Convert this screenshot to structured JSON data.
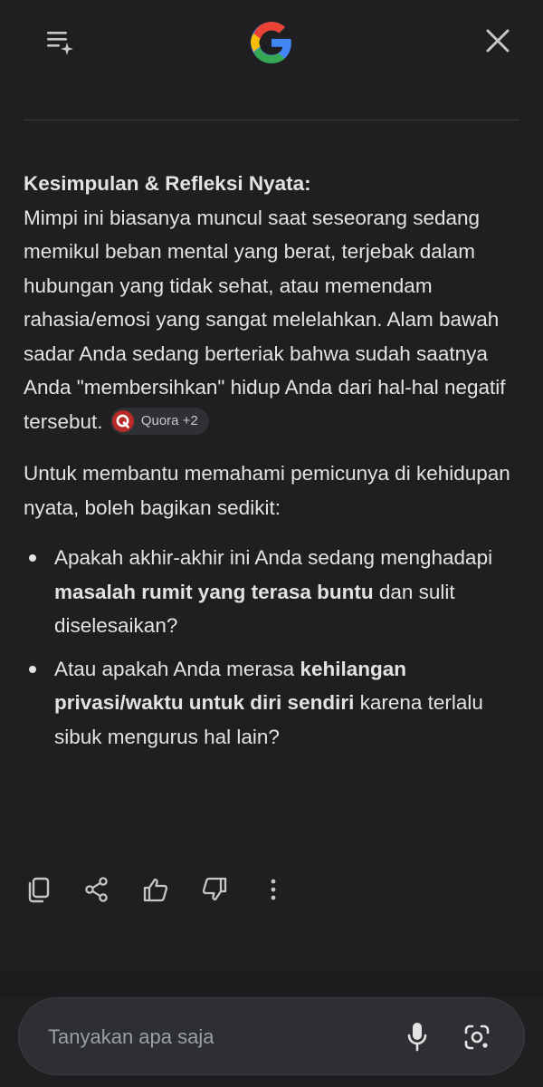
{
  "header": {
    "history_icon": "history-sparkle-icon",
    "logo_icon": "google-g-logo",
    "close_icon": "close-icon"
  },
  "answer": {
    "heading": "Kesimpulan & Refleksi Nyata:",
    "para1_text": "Mimpi ini biasanya muncul saat seseorang sedang memikul beban mental yang berat, terjebak dalam hubungan yang tidak sehat, atau memendam rahasia/emosi yang sangat melelahkan. Alam bawah sadar Anda sedang berteriak bahwa sudah saatnya Anda \"membersihkan\" hidup Anda dari hal-hal negatif tersebut.",
    "source_chip_label": "Quora +2",
    "para2_text": "Untuk membantu memahami pemicunya di kehidupan nyata, boleh bagikan sedikit:",
    "bullets": [
      {
        "pre": "Apakah akhir-akhir ini Anda sedang menghadapi ",
        "bold": "masalah rumit yang terasa buntu",
        "post": " dan sulit diselesaikan?"
      },
      {
        "pre": "Atau apakah Anda merasa ",
        "bold": "kehilangan privasi/waktu untuk diri sendiri",
        "post": " karena terlalu sibuk mengurus hal lain?"
      }
    ]
  },
  "actions": {
    "icons": [
      "copy-icon",
      "share-icon",
      "thumbs-up-icon",
      "thumbs-down-icon",
      "more-vert-icon"
    ]
  },
  "input": {
    "placeholder": "Tanyakan apa saja",
    "value": "",
    "mic_icon": "mic-icon",
    "lens_icon": "lens-icon"
  },
  "colors": {
    "background": "#1f1f21",
    "text": "#e3e3e3",
    "input_bg": "#2e2f33",
    "chip_bg": "#2f3033",
    "quora_red": "#b92b27",
    "google_blue": "#4285F4",
    "google_red": "#EA4335",
    "google_yellow": "#FBBC05",
    "google_green": "#34A853"
  }
}
